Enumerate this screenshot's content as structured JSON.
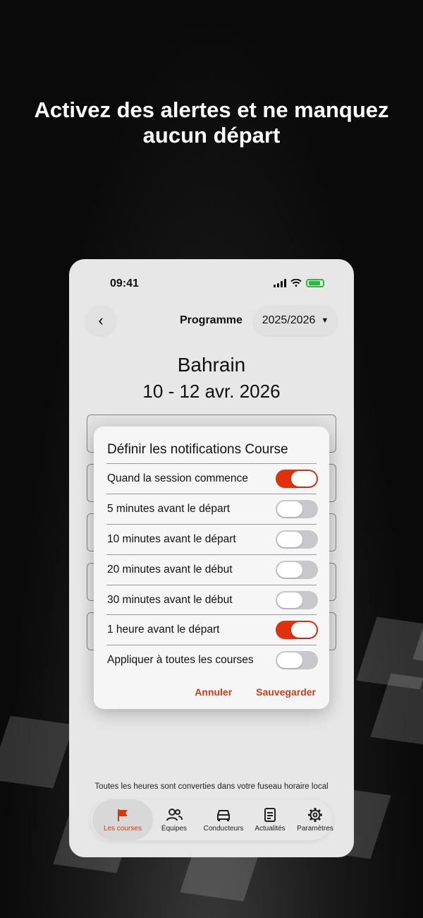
{
  "headline": "Activez des alertes et ne manquez aucun départ",
  "status_bar": {
    "time": "09:41"
  },
  "header": {
    "title": "Programme",
    "season": "2025/2026"
  },
  "race": {
    "name": "Bahrain",
    "dates": "10 - 12 avr. 2026"
  },
  "dialog": {
    "title": "Définir les notifications Course",
    "options": [
      {
        "label": "Quand la session commence",
        "on": true
      },
      {
        "label": "5 minutes avant le départ",
        "on": false
      },
      {
        "label": "10 minutes avant le départ",
        "on": false
      },
      {
        "label": "20 minutes avant le début",
        "on": false
      },
      {
        "label": "30 minutes avant le début",
        "on": false
      },
      {
        "label": "1 heure avant le départ",
        "on": true
      },
      {
        "label": "Appliquer à toutes les courses",
        "on": false
      }
    ],
    "cancel_label": "Annuler",
    "save_label": "Sauvegarder"
  },
  "footnote": "Toutes les heures sont converties dans votre fuseau horaire local",
  "tabs": [
    {
      "label": "Les courses",
      "icon": "flag-icon",
      "active": true
    },
    {
      "label": "Équipes",
      "icon": "people-icon",
      "active": false
    },
    {
      "label": "Conducteurs",
      "icon": "car-icon",
      "active": false
    },
    {
      "label": "Actualités",
      "icon": "document-icon",
      "active": false
    },
    {
      "label": "Paramètres",
      "icon": "gear-icon",
      "active": false
    }
  ],
  "colors": {
    "accent": "#e0300c",
    "toggle_off": "#c8c8cc"
  }
}
